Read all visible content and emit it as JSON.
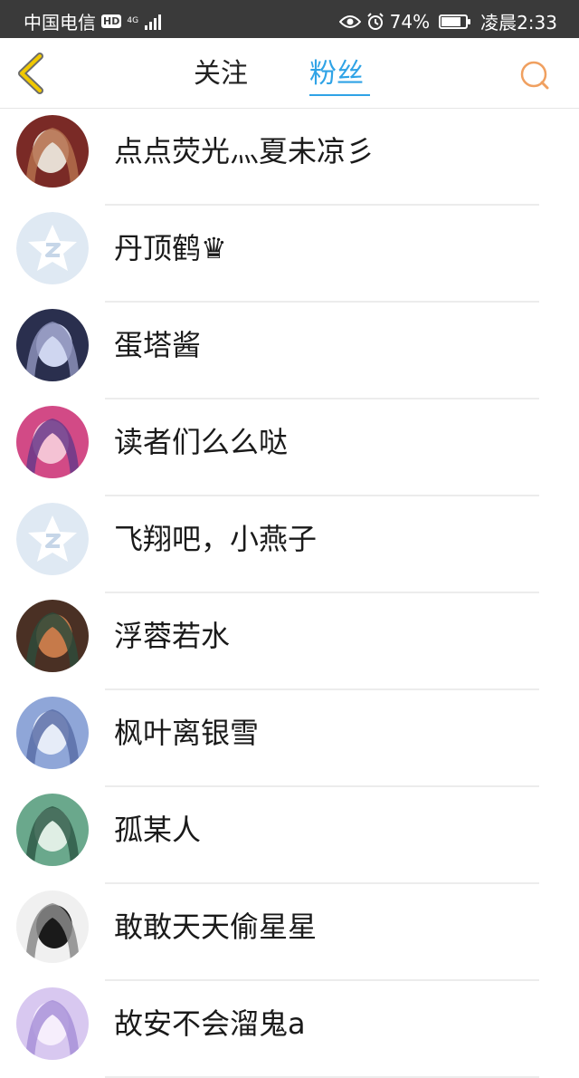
{
  "status_bar": {
    "carrier": "中国电信",
    "hd": "HD",
    "network": "4G",
    "battery": "74%",
    "battery_level": 0.74,
    "time": "凌晨2:33"
  },
  "nav": {
    "tabs": [
      {
        "label": "关注",
        "active": false
      },
      {
        "label": "粉丝",
        "active": true
      }
    ],
    "accent_color": "#2fa3e6",
    "back_icon_color": "#f0c800",
    "search_icon_color": "#f0a060"
  },
  "fans": [
    {
      "name": "点点荧光灬夏未凉彡",
      "avatar": "anime-avatar",
      "colors": [
        "#7a2a26",
        "#e6dcd2",
        "#b46e4c"
      ]
    },
    {
      "name": "丹顶鹤♛",
      "avatar": "default-qq-avatar",
      "colors": [
        "#dfe9f3",
        "#ffffff",
        "#c6d6e8"
      ]
    },
    {
      "name": "蛋塔酱",
      "avatar": "anime-avatar",
      "colors": [
        "#2a2f4e",
        "#cfd6f0",
        "#8b8fb8"
      ]
    },
    {
      "name": "读者们么么哒",
      "avatar": "anime-avatar",
      "colors": [
        "#d24a86",
        "#f4c2d4",
        "#6a3a8a"
      ]
    },
    {
      "name": "飞翔吧，小燕子",
      "avatar": "default-qq-avatar",
      "colors": [
        "#dfe9f3",
        "#ffffff",
        "#c6d6e8"
      ]
    },
    {
      "name": "浮蓉若水",
      "avatar": "anime-avatar",
      "colors": [
        "#4a3024",
        "#c67a4a",
        "#2e4a3a"
      ]
    },
    {
      "name": "枫叶离银雪",
      "avatar": "anime-avatar",
      "colors": [
        "#8fa6d8",
        "#e6ecf8",
        "#5a6ea8"
      ]
    },
    {
      "name": "孤某人",
      "avatar": "anime-avatar",
      "colors": [
        "#6aa88c",
        "#dfeee4",
        "#2f5a48"
      ]
    },
    {
      "name": "敢敢天天偷星星",
      "avatar": "photo-avatar",
      "colors": [
        "#f0f0f0",
        "#1a1a1a",
        "#8a8a8a"
      ]
    },
    {
      "name": "故安不会溜鬼a",
      "avatar": "anime-avatar",
      "colors": [
        "#d8c8f0",
        "#f6eefc",
        "#a890d8"
      ]
    }
  ]
}
